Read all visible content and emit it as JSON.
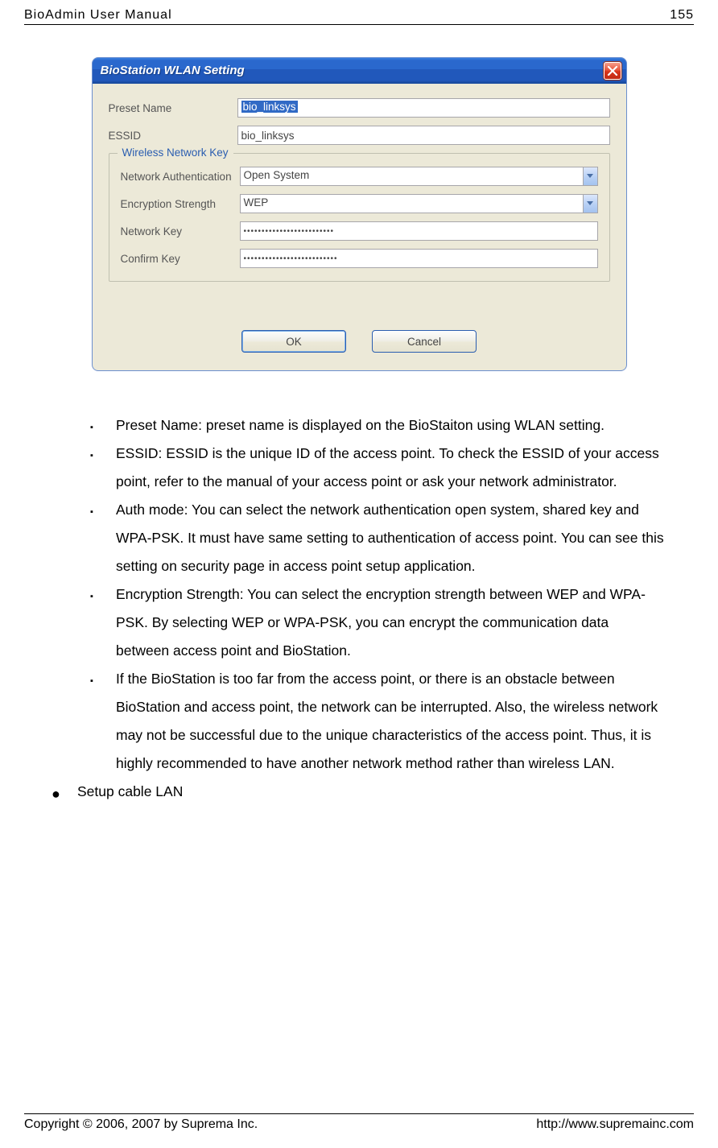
{
  "header": {
    "left": "BioAdmin User Manual",
    "right": "155"
  },
  "dialog": {
    "title": "BioStation WLAN Setting",
    "labels": {
      "preset_name": "Preset Name",
      "essid": "ESSID",
      "fieldset_legend": "Wireless Network Key",
      "network_auth": "Network Authentication",
      "encryption_strength": "Encryption Strength",
      "network_key": "Network Key",
      "confirm_key": "Confirm Key"
    },
    "values": {
      "preset_name": "bio_linksys",
      "essid": "bio_linksys",
      "network_auth": "Open System",
      "encryption_strength": "WEP",
      "network_key": "•••••••••••••••••••••••••",
      "confirm_key": "••••••••••••••••••••••••••"
    },
    "buttons": {
      "ok": "OK",
      "cancel": "Cancel"
    }
  },
  "body": {
    "b1": "Preset Name: preset name is displayed on the BioStaiton using WLAN setting.",
    "b2": "ESSID: ESSID is the unique ID of the access point. To check the ESSID of your access point, refer to the manual of your access point or ask your network administrator.",
    "b3": "Auth mode: You can select the network authentication open system, shared key and WPA-PSK. It must have same setting to authentication of access point. You can see this setting on security page in access point setup application.",
    "b4": "Encryption Strength: You can select the encryption strength between WEP and WPA-PSK. By selecting WEP or WPA-PSK, you can encrypt the communication data between access point and BioStation.",
    "b5": "If the BioStation is too far from the access point, or there is an obstacle between BioStation and access point, the network can be interrupted. Also, the wireless network may not be successful due to the unique characteristics of the access point. Thus, it is highly recommended to have another network method rather than wireless LAN.",
    "disc1": "Setup cable LAN"
  },
  "footer": {
    "left": "Copyright © 2006, 2007 by Suprema Inc.",
    "right": "http://www.supremainc.com"
  }
}
